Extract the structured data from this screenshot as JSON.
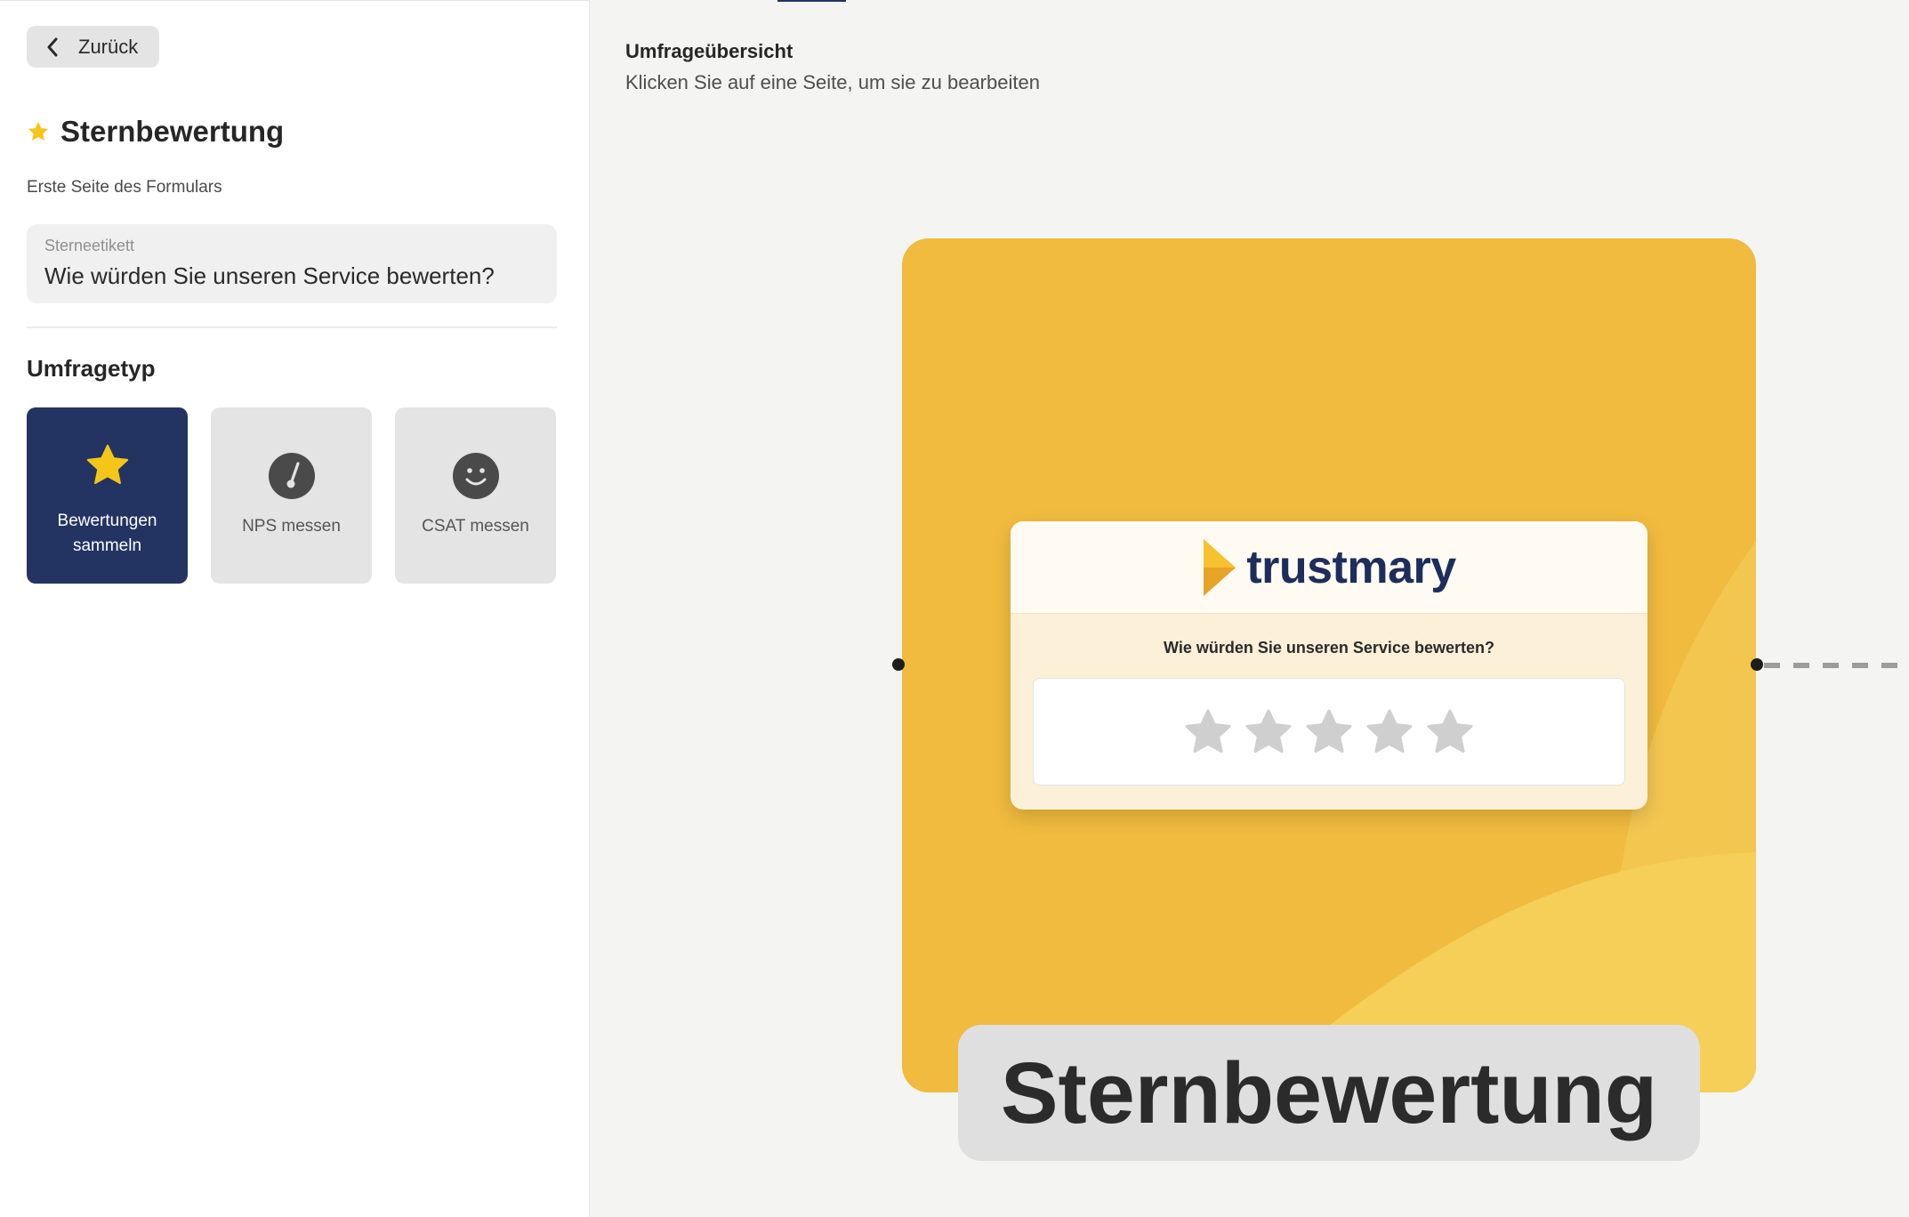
{
  "back": {
    "label": "Zurück"
  },
  "editor": {
    "title": "Sternbewertung",
    "subtitle": "Erste Seite des Formulars",
    "field": {
      "label": "Sterneetikett",
      "value": "Wie würden Sie unseren Service bewerten?"
    },
    "section_title": "Umfragetyp",
    "types": [
      {
        "label": "Bewertungen sammeln",
        "icon": "star-icon",
        "active": true
      },
      {
        "label": "NPS messen",
        "icon": "gauge-icon",
        "active": false
      },
      {
        "label": "CSAT messen",
        "icon": "smiley-icon",
        "active": false
      }
    ]
  },
  "overview": {
    "title": "Umfrageübersicht",
    "subtitle": "Klicken Sie auf eine Seite, um sie zu bearbeiten"
  },
  "preview": {
    "brand": "trustmary",
    "question": "Wie würden Sie unseren Service bewerten?",
    "star_count": 5,
    "page_label": "Sternbewertung"
  },
  "colors": {
    "accent": "#233463",
    "star": "#f5c518",
    "card_background": "#f0bb3e",
    "brand_text": "#1d2e5c"
  }
}
